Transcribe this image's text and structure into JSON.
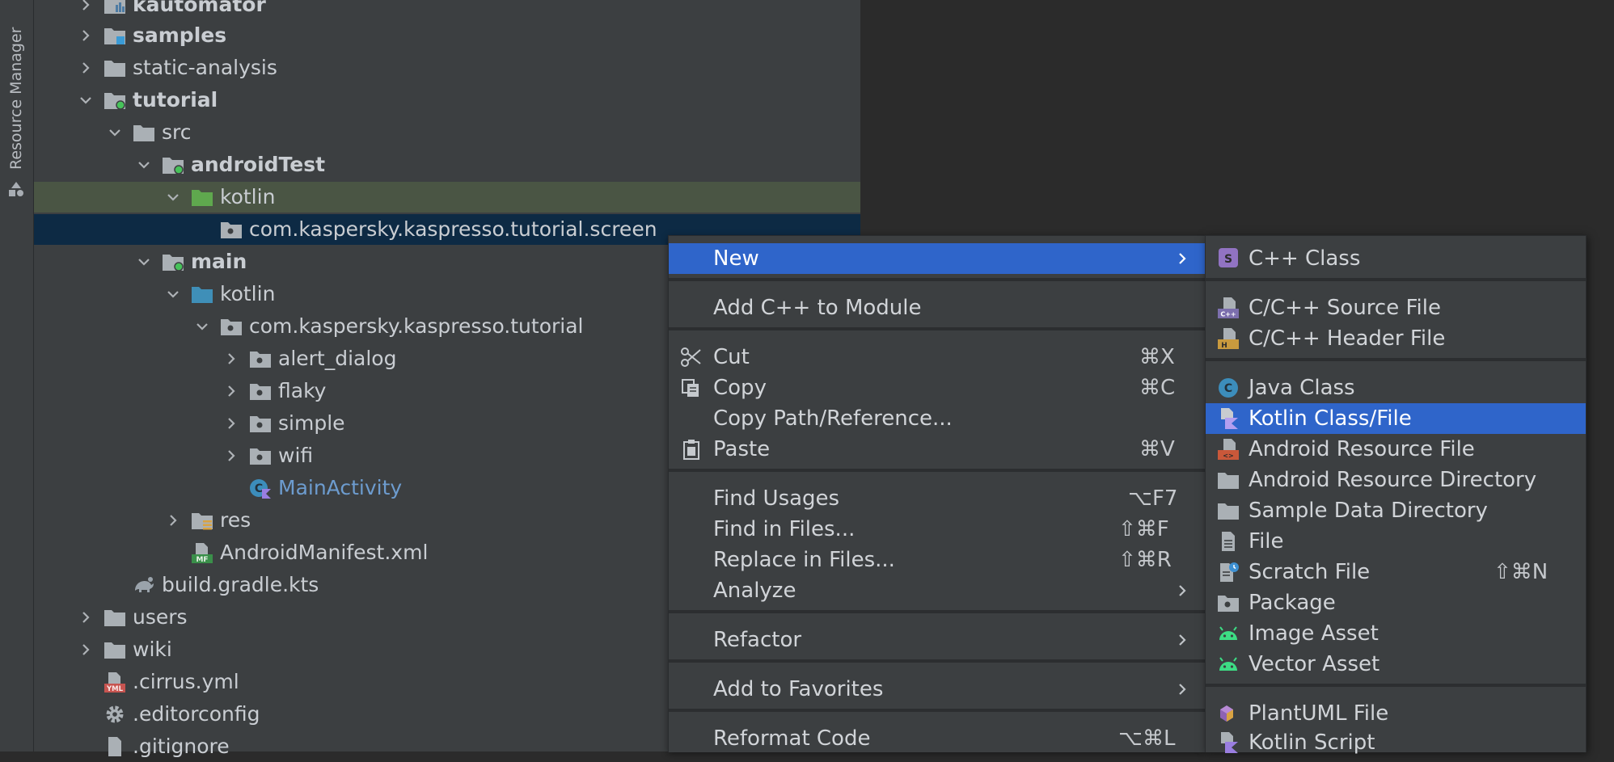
{
  "sidebar": {
    "label": "Resource Manager"
  },
  "tree": {
    "rows": [
      {
        "label": "kautomator",
        "bold": true
      },
      {
        "label": "samples",
        "bold": true
      },
      {
        "label": "static-analysis",
        "bold": false
      },
      {
        "label": "tutorial",
        "bold": true
      },
      {
        "label": "src",
        "bold": false
      },
      {
        "label": "androidTest",
        "bold": true
      },
      {
        "label": "kotlin",
        "bold": false
      },
      {
        "label": "com.kaspersky.kaspresso.tutorial.screen",
        "bold": false
      },
      {
        "label": "main",
        "bold": true
      },
      {
        "label": "kotlin",
        "bold": false
      },
      {
        "label": "com.kaspersky.kaspresso.tutorial",
        "bold": false
      },
      {
        "label": "alert_dialog",
        "bold": false
      },
      {
        "label": "flaky",
        "bold": false
      },
      {
        "label": "simple",
        "bold": false
      },
      {
        "label": "wifi",
        "bold": false
      },
      {
        "label": "MainActivity",
        "bold": false
      },
      {
        "label": "res",
        "bold": false
      },
      {
        "label": "AndroidManifest.xml",
        "bold": false
      },
      {
        "label": "build.gradle.kts",
        "bold": false
      },
      {
        "label": "users",
        "bold": false
      },
      {
        "label": "wiki",
        "bold": false
      },
      {
        "label": ".cirrus.yml",
        "bold": false
      },
      {
        "label": ".editorconfig",
        "bold": false
      },
      {
        "label": ".gitignore",
        "bold": false
      }
    ]
  },
  "context_menu": {
    "items": [
      {
        "label": "New",
        "shortcut": "",
        "submenu": true,
        "selected": true
      },
      {
        "label": "Add C++ to Module",
        "shortcut": ""
      },
      {
        "label": "Cut",
        "shortcut": "⌘X",
        "icon": "scissors-icon"
      },
      {
        "label": "Copy",
        "shortcut": "⌘C",
        "icon": "copy-icon"
      },
      {
        "label": "Copy Path/Reference...",
        "shortcut": ""
      },
      {
        "label": "Paste",
        "shortcut": "⌘V",
        "icon": "clipboard-icon"
      },
      {
        "label": "Find Usages",
        "shortcut": "⌥F7"
      },
      {
        "label": "Find in Files...",
        "shortcut": "⇧⌘F"
      },
      {
        "label": "Replace in Files...",
        "shortcut": "⇧⌘R"
      },
      {
        "label": "Analyze",
        "shortcut": "",
        "submenu": true
      },
      {
        "label": "Refactor",
        "shortcut": "",
        "submenu": true
      },
      {
        "label": "Add to Favorites",
        "shortcut": "",
        "submenu": true
      },
      {
        "label": "Reformat Code",
        "shortcut": "⌥⌘L"
      }
    ]
  },
  "new_submenu": {
    "items": [
      {
        "label": "C++ Class",
        "icon": "cpp-class-icon"
      },
      {
        "label": "C/C++ Source File",
        "icon": "cpp-source-icon"
      },
      {
        "label": "C/C++ Header File",
        "icon": "cpp-header-icon"
      },
      {
        "label": "Java Class",
        "icon": "java-class-icon"
      },
      {
        "label": "Kotlin Class/File",
        "icon": "kotlin-file-icon",
        "selected": true
      },
      {
        "label": "Android Resource File",
        "icon": "android-resource-file-icon"
      },
      {
        "label": "Android Resource Directory",
        "icon": "folder-icon"
      },
      {
        "label": "Sample Data Directory",
        "icon": "folder-icon"
      },
      {
        "label": "File",
        "icon": "file-icon"
      },
      {
        "label": "Scratch File",
        "icon": "scratch-file-icon",
        "shortcut": "⇧⌘N"
      },
      {
        "label": "Package",
        "icon": "package-icon"
      },
      {
        "label": "Image Asset",
        "icon": "android-icon"
      },
      {
        "label": "Vector Asset",
        "icon": "android-icon"
      },
      {
        "label": "PlantUML File",
        "icon": "plantuml-icon"
      },
      {
        "label": "Kotlin Script",
        "icon": "kotlin-script-icon"
      }
    ]
  },
  "colors": {
    "selection": "#2f65ca",
    "tree_selection": "#0d2a44",
    "tree_focus_row": "#4a5544",
    "panel_bg": "#3c3f41",
    "editor_bg": "#2b2b2b"
  }
}
